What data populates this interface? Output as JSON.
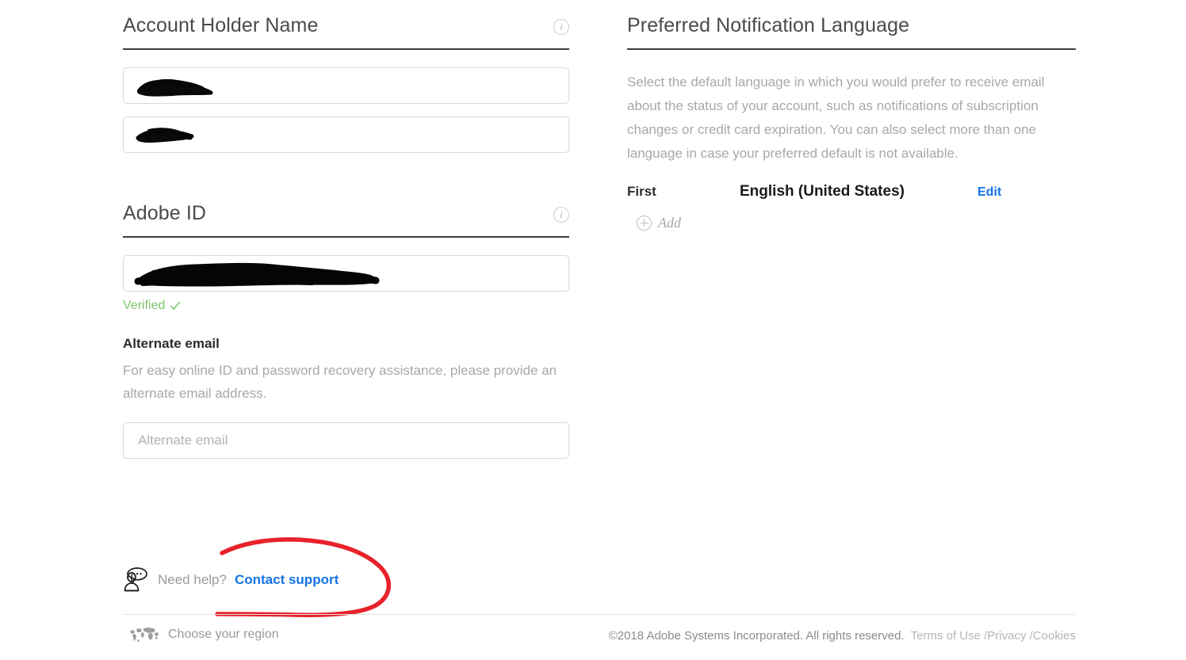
{
  "left_column": {
    "account_holder": {
      "heading": "Account Holder Name",
      "info_icon": "info-icon",
      "first_name_value": "",
      "first_name_redacted": true,
      "last_name_value": "",
      "last_name_redacted": true
    },
    "adobe_id": {
      "heading": "Adobe ID",
      "info_icon": "info-icon",
      "value": "",
      "redacted": true,
      "status_label": "Verified",
      "status_color": "#7ec46b",
      "status_icon": "checkmark-icon"
    },
    "alternate_email": {
      "title": "Alternate email",
      "description": "For easy online ID and password recovery assistance, please provide an alternate email address.",
      "placeholder": "Alternate email",
      "value": ""
    }
  },
  "right_column": {
    "notification_language": {
      "heading": "Preferred Notification Language",
      "description": "Select the default language in which you would prefer to receive email about the status of your account, such as notifications of subscription changes or credit card expiration. You can also select more than one language in case your preferred default is not available.",
      "rows": [
        {
          "rank": "First",
          "language": "English (United States)",
          "action": "Edit"
        }
      ],
      "add_label": "Add",
      "add_icon": "plus-circle-icon"
    }
  },
  "help": {
    "icon": "support-person-icon",
    "prompt": "Need help?",
    "link": "Contact support"
  },
  "footer": {
    "region_icon": "world-map-icon",
    "region_label": "Choose your region",
    "copyright": "©2018 Adobe Systems Incorporated. All rights reserved.",
    "links": "Terms of Use /Privacy /Cookies"
  },
  "annotation": {
    "type": "hand-drawn-oval",
    "color": "#e8222a",
    "target": "Contact support"
  },
  "colors": {
    "accent_link": "#1473e6",
    "verified_green": "#7ec46b",
    "annotation_red": "#e8222a",
    "heading_text": "#4a4a4a",
    "muted_text": "#a8a8a8"
  }
}
